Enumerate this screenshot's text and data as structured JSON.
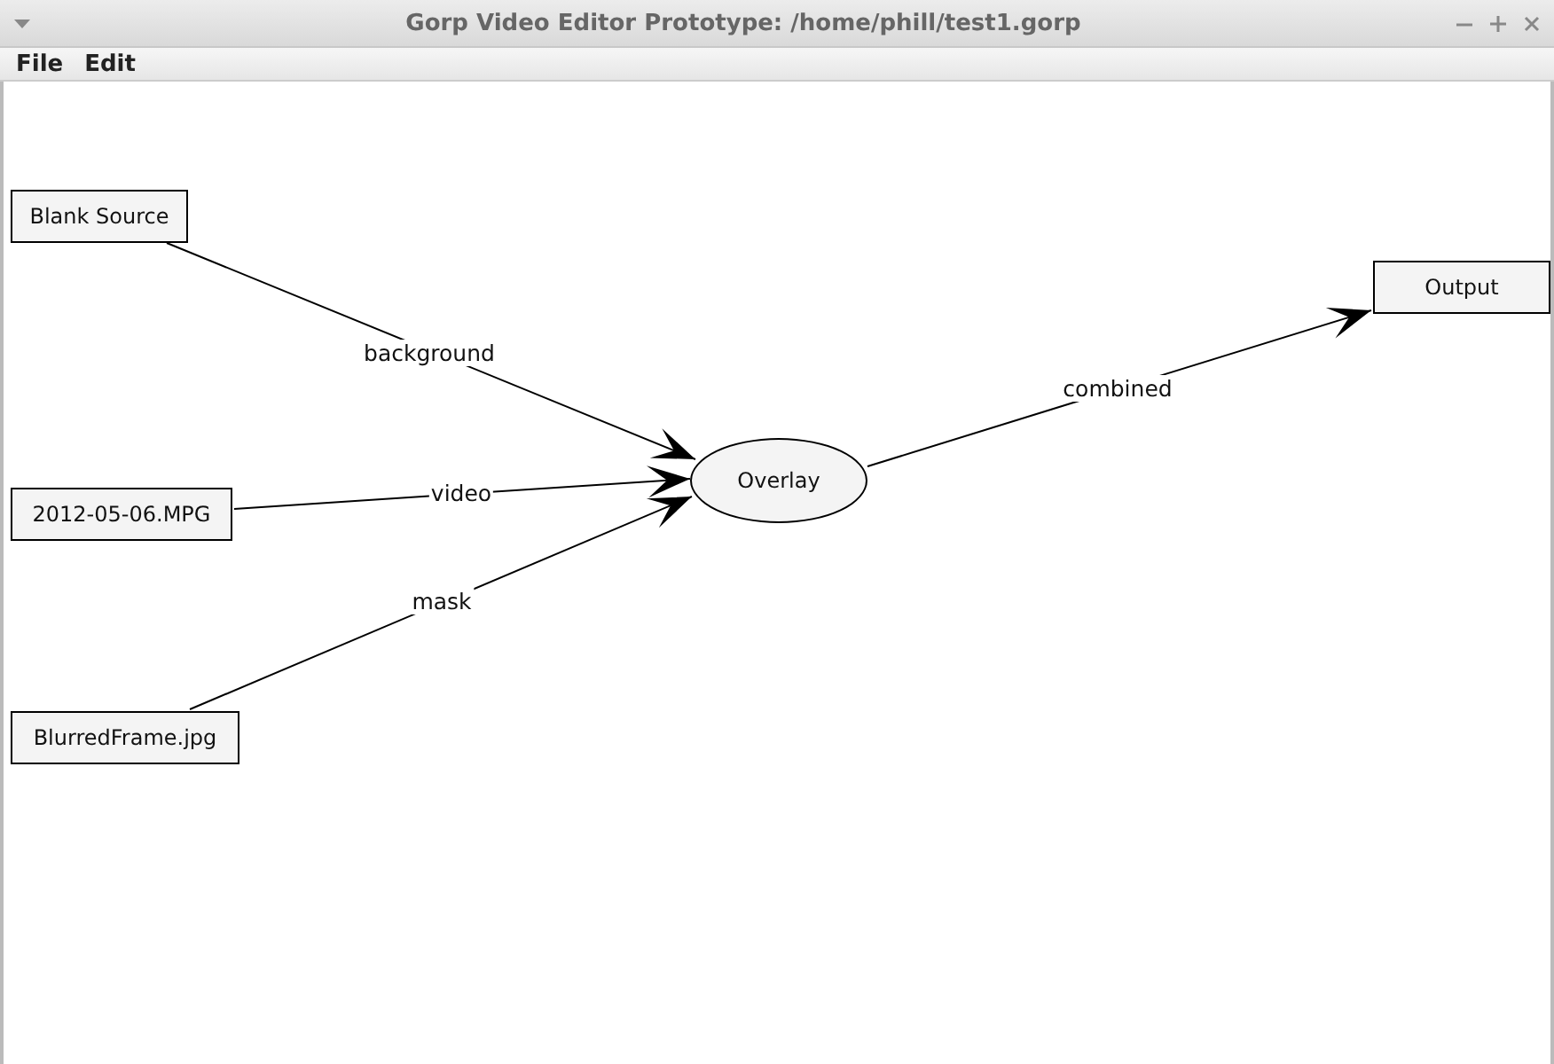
{
  "window": {
    "title": "Gorp Video Editor Prototype: /home/phill/test1.gorp"
  },
  "menu": [
    "File",
    "Edit"
  ],
  "graph": {
    "nodes": [
      {
        "label": "Blank Source",
        "kind": "box"
      },
      {
        "label": "2012-05-06.MPG",
        "kind": "box"
      },
      {
        "label": "BlurredFrame.jpg",
        "kind": "box"
      },
      {
        "label": "Overlay",
        "kind": "ellipse"
      },
      {
        "label": "Output",
        "kind": "box"
      }
    ],
    "edges": [
      {
        "label": "background"
      },
      {
        "label": "video"
      },
      {
        "label": "mask"
      },
      {
        "label": "combined"
      }
    ]
  }
}
